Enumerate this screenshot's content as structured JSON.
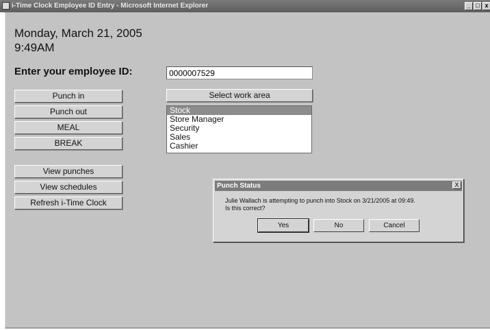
{
  "window": {
    "title": "i-Time Clock  Employee ID Entry - Microsoft Internet Explorer",
    "controls": {
      "minimize": "_",
      "maximize": "□",
      "close": "x"
    }
  },
  "header": {
    "date": "Monday, March 21, 2005",
    "time": "9:49AM"
  },
  "employee": {
    "label": "Enter your employee ID:",
    "id_value": "0000007529"
  },
  "punch_buttons": [
    "Punch in",
    "Punch out",
    "MEAL",
    "BREAK"
  ],
  "view_buttons": [
    "View punches",
    "View schedules",
    "Refresh i-Time Clock"
  ],
  "work_area": {
    "button_label": "Select work area",
    "options": [
      "Stock",
      "Store Manager",
      "Security",
      "Sales",
      "Cashier"
    ],
    "selected": "Stock"
  },
  "dialog": {
    "title": "Punch Status",
    "close": "X",
    "message_line1": "Julie Wallach is attempting to punch into Stock on 3/21/2005 at 09:49.",
    "message_line2": "Is this correct?",
    "buttons": {
      "yes": "Yes",
      "no": "No",
      "cancel": "Cancel"
    }
  }
}
